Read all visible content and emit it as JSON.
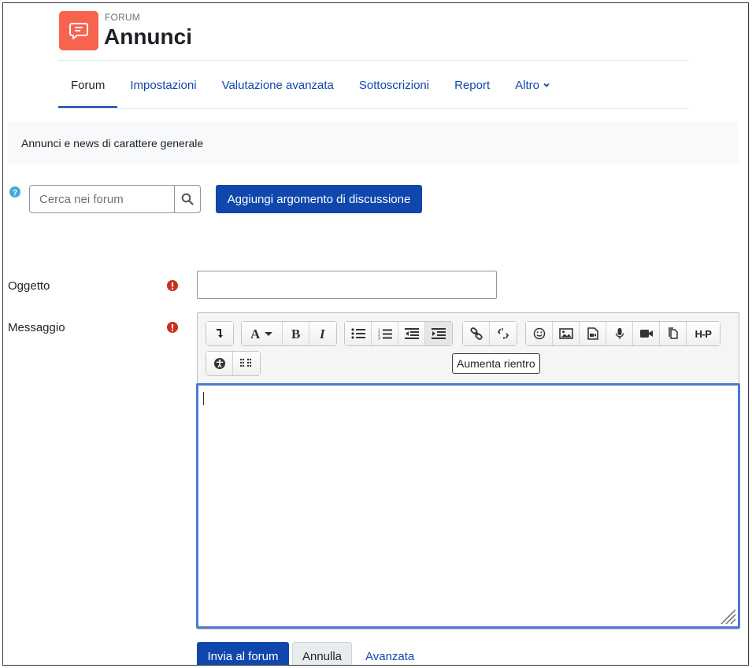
{
  "header": {
    "kicker": "FORUM",
    "title": "Annunci",
    "icon": "forum-icon",
    "icon_color": "#f7634d"
  },
  "nav": {
    "tabs": [
      {
        "label": "Forum",
        "active": true
      },
      {
        "label": "Impostazioni"
      },
      {
        "label": "Valutazione avanzata"
      },
      {
        "label": "Sottoscrizioni"
      },
      {
        "label": "Report"
      },
      {
        "label": "Altro"
      }
    ]
  },
  "intro": "Annunci e news di carattere generale",
  "search": {
    "placeholder": "Cerca nei forum",
    "value": ""
  },
  "add_topic_label": "Aggiungi argomento di discussione",
  "form": {
    "subject_label": "Oggetto",
    "subject_value": "",
    "message_label": "Messaggio",
    "editor_tooltip": "Aumenta rientro",
    "toolbar": {
      "h5p_label": "H-P"
    }
  },
  "buttons": {
    "submit": "Invia al forum",
    "cancel": "Annulla",
    "advanced": "Avanzata"
  },
  "colors": {
    "primary": "#0f47ad",
    "required": "#ca3120",
    "help": "#48a9d8"
  }
}
